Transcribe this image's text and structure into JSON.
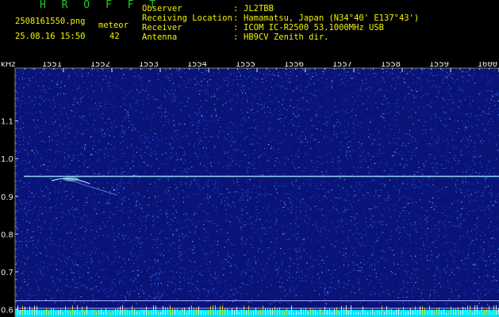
{
  "header": {
    "title": "H R O F F T",
    "filename": "2508161550.png",
    "datetime": "25.08.16 15:50",
    "event_type": "meteor",
    "event_count": "42",
    "fields": [
      {
        "label": "Observer",
        "sep": ":",
        "value": "JL2TBB"
      },
      {
        "label": "Receiving Location",
        "sep": ":",
        "value": "Hamamatsu, Japan (N34°40' E137°43')"
      },
      {
        "label": "Receiver",
        "sep": ":",
        "value": "ICOM IC-R2500 53.1000MHz USB"
      },
      {
        "label": "Antenna",
        "sep": ":",
        "value": "HB9CV Zenith dir."
      }
    ],
    "colors": {
      "title": "#22cc22",
      "text": "#f2f200",
      "tick_text": "#e8e8e8"
    }
  },
  "chart_data": {
    "type": "heatmap",
    "ylabel": "kHz",
    "x_tick_labels": [
      "1551",
      "1552",
      "1553",
      "1554",
      "1555",
      "1556",
      "1557",
      "1558",
      "1559",
      "1600"
    ],
    "y_tick_labels": [
      "1.1",
      "1.0",
      "0.9",
      "0.8",
      "0.7",
      "0.6"
    ],
    "y_ticks": [
      1.1,
      1.0,
      0.9,
      0.8,
      0.7,
      0.6
    ],
    "xlim": [
      1550.0,
      1600.0
    ],
    "ylim": [
      0.58,
      1.24
    ],
    "background_color": "#0a1478",
    "noise_colors": [
      "#2a4cff",
      "#3f7fff",
      "#5aa8ff",
      "#9ad8ff",
      "#d0f4ff"
    ],
    "carrier": {
      "freq_khz": 0.953,
      "start": 1550.9,
      "end": 1600,
      "color": "#9fe8ff"
    },
    "meteor_echo": {
      "time": 1555.6,
      "freq_khz": 0.95,
      "color": "#b0f0ff"
    },
    "bottom_lines_khz": [
      0.623,
      0.603
    ],
    "bottom_line_color": "#a8a8ff",
    "bottom_band_color": "#00e5ff",
    "bottom_spike_color": "#f2f200"
  }
}
